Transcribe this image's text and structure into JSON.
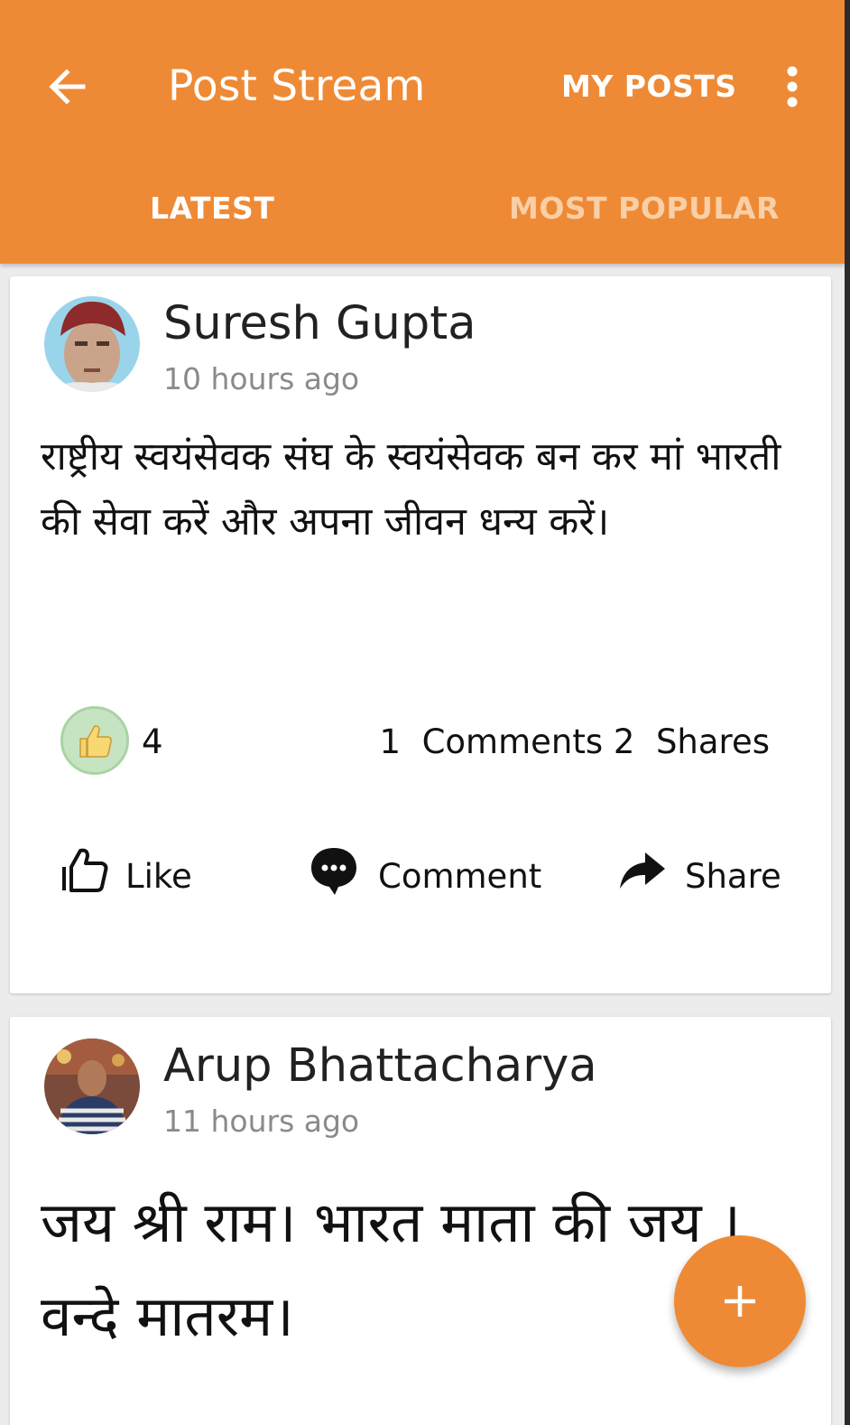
{
  "appbar": {
    "title": "Post Stream",
    "action_label": "MY POSTS",
    "back_icon": "arrow-left-icon",
    "overflow_icon": "more-vertical-icon",
    "color": "#ee8a35"
  },
  "tabs": [
    {
      "label": "LATEST",
      "selected": true
    },
    {
      "label": "MOST POPULAR",
      "selected": false
    }
  ],
  "posts": [
    {
      "author": "Suresh Gupta",
      "time": "10 hours ago",
      "text": "राष्ट्रीय स्वयंसेवक संघ के स्वयंसेवक बन कर मां भारती की सेवा करें और अपना जीवन धन्य करें।",
      "likes": "4",
      "stats": "1  Comments 2  Shares",
      "actions": {
        "like": "Like",
        "comment": "Comment",
        "share": "Share"
      }
    },
    {
      "author": "Arup Bhattacharya",
      "time": "11 hours ago",
      "text": "जय श्री राम। भारत माता की जय । वन्दे मातरम।"
    }
  ],
  "fab": {
    "icon": "plus-icon"
  }
}
